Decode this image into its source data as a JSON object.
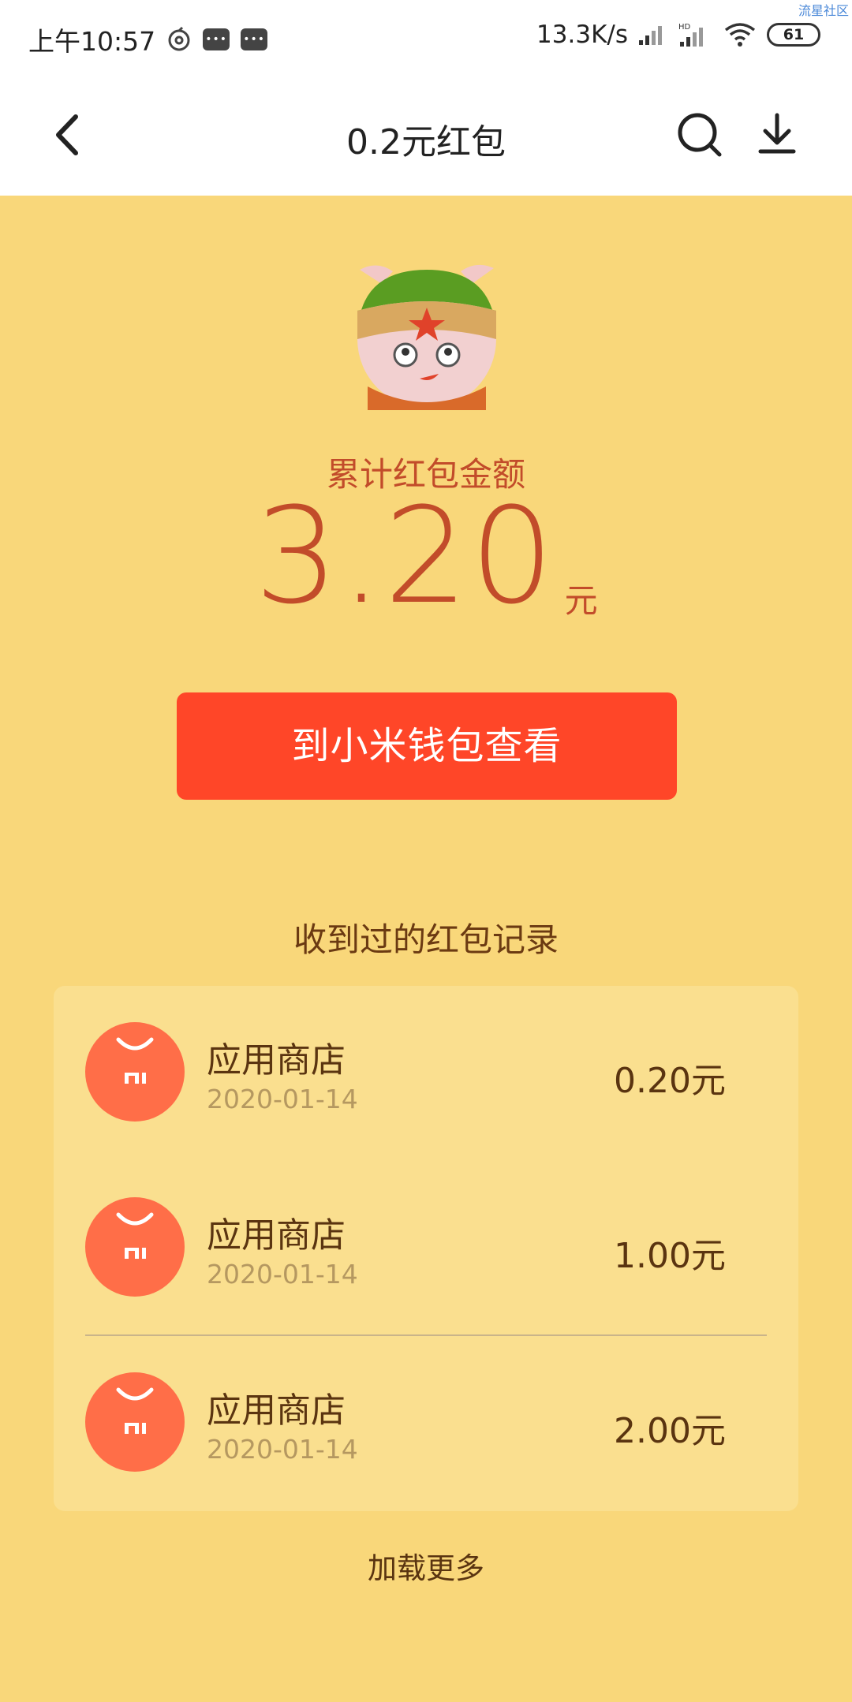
{
  "status_bar": {
    "time": "上午10:57",
    "network_speed": "13.3K/s",
    "battery": "61",
    "hd_label": "HD",
    "watermark": "流星社区",
    "icons": [
      "netease-icon",
      "message-icon",
      "message-icon",
      "signal-icon",
      "hd-signal-icon",
      "wifi-icon",
      "battery-icon"
    ]
  },
  "header": {
    "title": "0.2元红包",
    "back_icon": "chevron-left-icon",
    "search_icon": "search-icon",
    "download_icon": "download-icon"
  },
  "summary": {
    "label": "累计红包金额",
    "amount": "3.20",
    "unit": "元",
    "button_label": "到小米钱包查看"
  },
  "records": {
    "title": "收到过的红包记录",
    "items": [
      {
        "name": "应用商店",
        "date": "2020-01-14",
        "amount": "0.20元"
      },
      {
        "name": "应用商店",
        "date": "2020-01-14",
        "amount": "1.00元"
      },
      {
        "name": "应用商店",
        "date": "2020-01-14",
        "amount": "2.00元"
      }
    ],
    "load_more": "加载更多"
  },
  "colors": {
    "background": "#f9d77a",
    "card": "#fadf8f",
    "accent_red": "#ff4628",
    "amount_red": "#c24c2a",
    "store_icon": "#ff6e48"
  }
}
